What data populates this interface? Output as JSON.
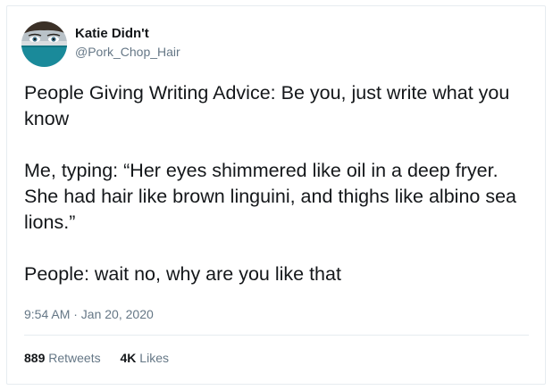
{
  "user": {
    "display_name": "Katie Didn't",
    "handle": "@Pork_Chop_Hair"
  },
  "tweet": {
    "paragraphs": [
      "People Giving Writing Advice: Be you, just write what you know",
      "Me, typing: “Her eyes shimmered like oil in a deep fryer. She had hair like brown linguini, and thighs like albino sea lions.”",
      "People: wait no, why are you like that"
    ],
    "timestamp": "9:54 AM · Jan 20, 2020"
  },
  "stats": {
    "retweets_count": "889",
    "retweets_label": " Retweets",
    "likes_count": "4K",
    "likes_label": " Likes"
  },
  "colors": {
    "text": "#14171a",
    "secondary": "#657786",
    "border": "#e6ecf0",
    "avatar_mask": "#1a8a9a"
  }
}
